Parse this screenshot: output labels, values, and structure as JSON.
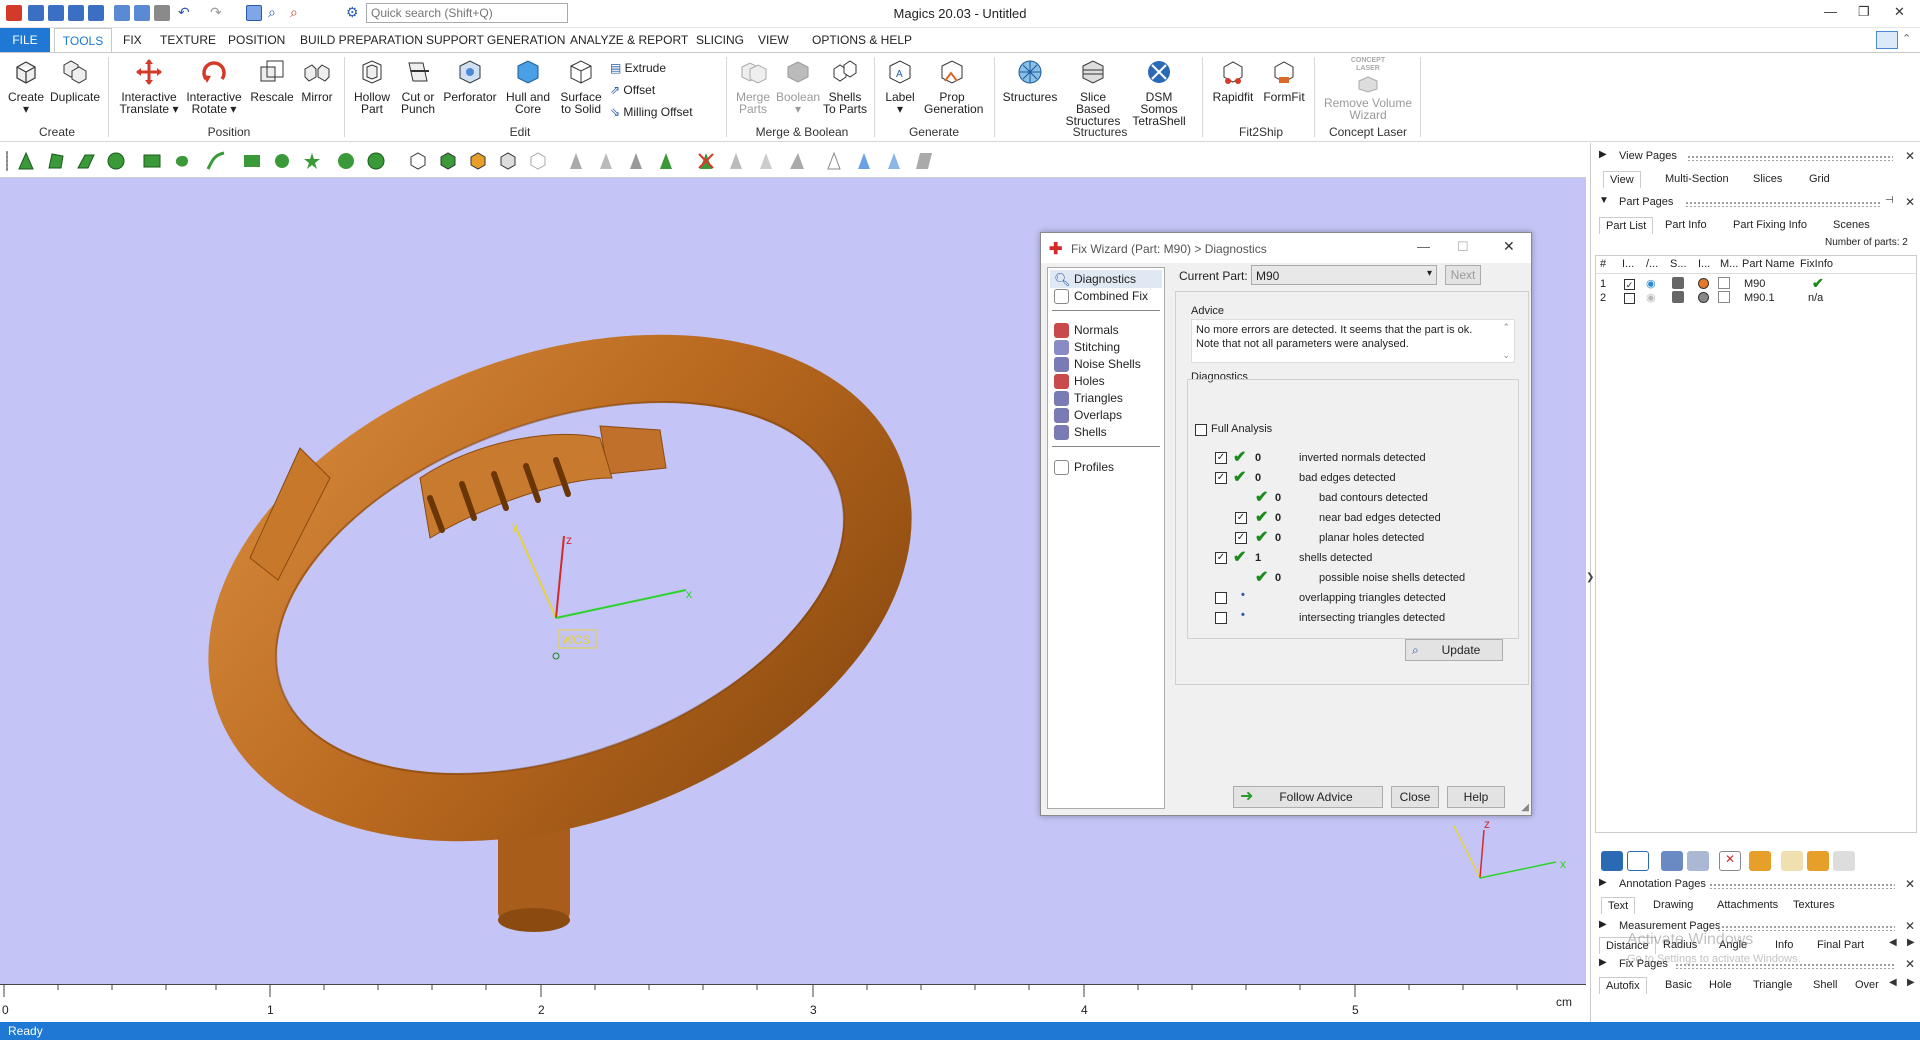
{
  "titlebar": {
    "title": "Magics 20.03 - Untitled",
    "search_placeholder": "Quick search (Shift+Q)"
  },
  "tabs": [
    "FILE",
    "TOOLS",
    "FIX",
    "TEXTURE",
    "POSITION",
    "BUILD PREPARATION",
    "SUPPORT GENERATION",
    "ANALYZE & REPORT",
    "SLICING",
    "VIEW",
    "OPTIONS & HELP"
  ],
  "ribbon": {
    "create": "Create",
    "duplicate": "Duplicate",
    "group_create": "Create",
    "interactive_translate": [
      "Interactive",
      "Translate"
    ],
    "interactive_rotate": [
      "Interactive",
      "Rotate"
    ],
    "rescale": "Rescale",
    "mirror": "Mirror",
    "group_position": "Position",
    "hollow_part": [
      "Hollow",
      "Part"
    ],
    "cut_or_punch": [
      "Cut or",
      "Punch"
    ],
    "perforator": "Perforator",
    "hull_and_core": [
      "Hull and",
      "Core"
    ],
    "surface_to_solid": [
      "Surface",
      "to Solid"
    ],
    "extrude": "Extrude",
    "offset": "Offset",
    "milling_offset": "Milling Offset",
    "group_edit": "Edit",
    "merge_parts": [
      "Merge",
      "Parts"
    ],
    "boolean": "Boolean",
    "shells_to_parts": [
      "Shells",
      "To Parts"
    ],
    "group_merge": "Merge & Boolean",
    "label": "Label",
    "prop_generation": [
      "Prop",
      "Generation"
    ],
    "group_generate": "Generate",
    "structures": "Structures",
    "slice_based": [
      "Slice Based",
      "Structures"
    ],
    "dsm_somos": [
      "DSM Somos",
      "TetraShell"
    ],
    "group_structures": "Structures",
    "rapidfit": "Rapidfit",
    "formfit": "FormFit",
    "group_fit2ship": "Fit2Ship",
    "concept_laser_logo": [
      "CONCEPT",
      "LASER"
    ],
    "remove_volume": [
      "Remove Volume",
      "Wizard"
    ],
    "group_concept": "Concept Laser"
  },
  "viewport": {
    "wcs_label": "WCS",
    "axis_x": "x",
    "axis_y": "y",
    "axis_z": "z",
    "background": "#c4c4f6",
    "part_color": "#c87a2e"
  },
  "ruler": {
    "ticks": [
      "0",
      "1",
      "2",
      "3",
      "4",
      "5"
    ],
    "unit": "cm"
  },
  "status": "Ready",
  "dialog": {
    "title": "Fix Wizard (Part: M90) > Diagnostics",
    "nav": {
      "diagnostics": "Diagnostics",
      "combined_fix": "Combined Fix",
      "normals": "Normals",
      "stitching": "Stitching",
      "noise_shells": "Noise Shells",
      "holes": "Holes",
      "triangles": "Triangles",
      "overlaps": "Overlaps",
      "shells": "Shells",
      "profiles": "Profiles"
    },
    "current_part_label": "Current Part:",
    "current_part_value": "M90",
    "next_label": "Next",
    "advice_title": "Advice",
    "advice_line1": "No more errors are detected. It seems that the part is ok.",
    "advice_line2": "Note that not all parameters were analysed.",
    "diagnostics_title": "Diagnostics",
    "full_analysis": "Full Analysis",
    "rows": [
      {
        "count": "0",
        "text": "inverted normals detected"
      },
      {
        "count": "0",
        "text": "bad edges detected"
      },
      {
        "count": "0",
        "text": "bad contours detected"
      },
      {
        "count": "0",
        "text": "near bad edges detected"
      },
      {
        "count": "0",
        "text": "planar holes detected"
      },
      {
        "count": "1",
        "text": "shells detected"
      },
      {
        "count": "0",
        "text": "possible noise shells detected"
      },
      {
        "count": "",
        "text": "overlapping triangles detected"
      },
      {
        "count": "",
        "text": "intersecting triangles detected"
      }
    ],
    "update": "Update",
    "follow_advice": "Follow Advice",
    "close": "Close",
    "help": "Help"
  },
  "right_panel": {
    "view_pages": "View Pages",
    "view_tabs": [
      "View",
      "Multi-Section",
      "Slices",
      "Grid"
    ],
    "part_pages": "Part Pages",
    "part_tabs": [
      "Part List",
      "Part Info",
      "Part Fixing Info",
      "Scenes"
    ],
    "number_of_parts": "Number of parts: 2",
    "columns": [
      "#",
      "I...",
      "/...",
      "S...",
      "I...",
      "M...",
      "Part Name",
      "FixInfo"
    ],
    "parts": [
      {
        "num": "1",
        "name": "M90",
        "fixinfo": "✔"
      },
      {
        "num": "2",
        "name": "M90.1",
        "fixinfo": "n/a"
      }
    ],
    "annotation_pages": "Annotation Pages",
    "annotation_tabs": [
      "Text",
      "Drawing",
      "Attachments",
      "Textures"
    ],
    "measurement_pages": "Measurement Pages",
    "measurement_tabs": [
      "Distance",
      "Radius",
      "Angle",
      "Info",
      "Final Part"
    ],
    "fix_pages": "Fix Pages",
    "fix_tabs": [
      "Autofix",
      "Basic",
      "Hole",
      "Triangle",
      "Shell",
      "Over"
    ],
    "watermark1": "Activate Windows",
    "watermark2": "Go to Settings to activate Windows."
  }
}
